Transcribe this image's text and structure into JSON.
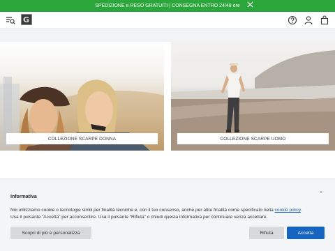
{
  "promo": {
    "text_lead": "SPEDIZIONE e RESO GRATUITI",
    "text_separator": " | ",
    "text_tail": "CONSEGNA ENTRO 24/48 ore",
    "close_icon": "close-icon",
    "bg_color": "#2aa63a"
  },
  "header": {
    "logo_letter": "G",
    "icons": [
      "menu-search-icon",
      "help-icon",
      "user-icon",
      "bag-icon"
    ]
  },
  "tiles": [
    {
      "label": "COLLEZIONE SCARPE DONNA"
    },
    {
      "label": "COLLEZIONE SCARPE UOMO"
    }
  ],
  "cookie_banner": {
    "title": "Informativa",
    "text_line1_before_link": "Noi utilizziamo cookie o tecnologie simili per finalità tecniche e, con il tuo consenso, anche per altre finalità come specificato nella ",
    "link_text": "cookie policy",
    "text_line1_after_link": ".",
    "text_line2": "Usa il pulsante “Accetta” per acconsentire. Usa il pulsante “Rifiuta” o chiudi questa informativa per continuare senza accettare.",
    "close_glyph": "×",
    "buttons": {
      "more": "Scopri di più e personalizza",
      "reject": "Rifiuta",
      "accept": "Accetta"
    },
    "accept_color": "#1565c0"
  }
}
